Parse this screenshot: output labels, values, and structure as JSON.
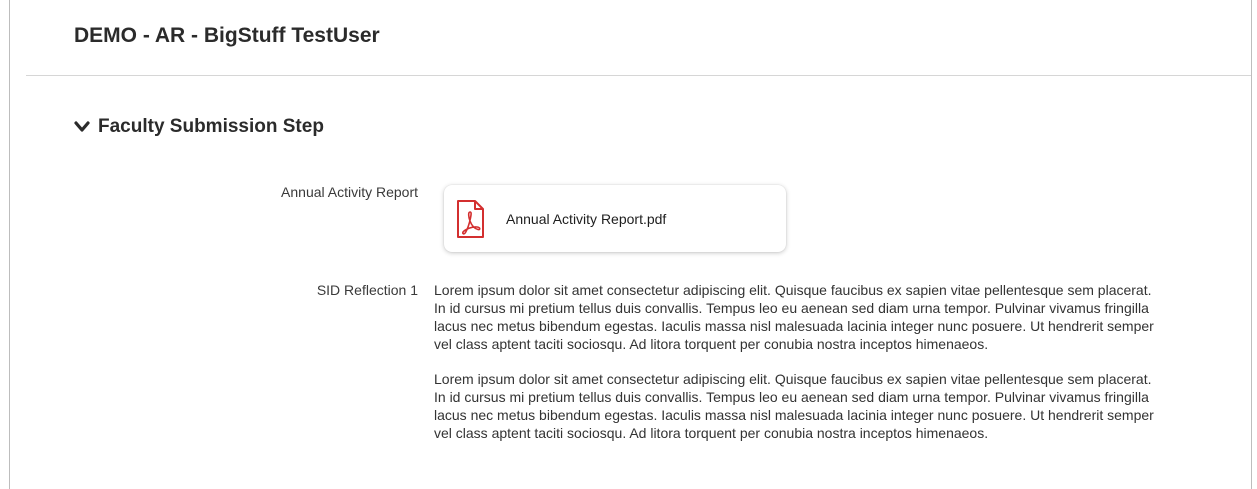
{
  "header": {
    "title": "DEMO - AR - BigStuff TestUser"
  },
  "section": {
    "title": "Faculty Submission Step",
    "toggle_icon": "chevron-down-icon"
  },
  "fields": {
    "annual_activity_report": {
      "label": "Annual Activity Report",
      "file_name": "Annual Activity Report.pdf",
      "file_icon": "pdf-icon",
      "icon_color": "#d32f2f"
    },
    "sid_reflection_1": {
      "label": "SID Reflection 1",
      "paragraphs": [
        "Lorem ipsum dolor sit amet consectetur adipiscing elit. Quisque faucibus ex sapien vitae pellentesque sem placerat. In id cursus mi pretium tellus duis convallis. Tempus leo eu aenean sed diam urna tempor. Pulvinar vivamus fringilla lacus nec metus bibendum egestas. Iaculis massa nisl malesuada lacinia integer nunc posuere. Ut hendrerit semper vel class aptent taciti sociosqu. Ad litora torquent per conubia nostra inceptos himenaeos.",
        "Lorem ipsum dolor sit amet consectetur adipiscing elit. Quisque faucibus ex sapien vitae pellentesque sem placerat. In id cursus mi pretium tellus duis convallis. Tempus leo eu aenean sed diam urna tempor. Pulvinar vivamus fringilla lacus nec metus bibendum egestas. Iaculis massa nisl malesuada lacinia integer nunc posuere. Ut hendrerit semper vel class aptent taciti sociosqu. Ad litora torquent per conubia nostra inceptos himenaeos."
      ]
    }
  }
}
